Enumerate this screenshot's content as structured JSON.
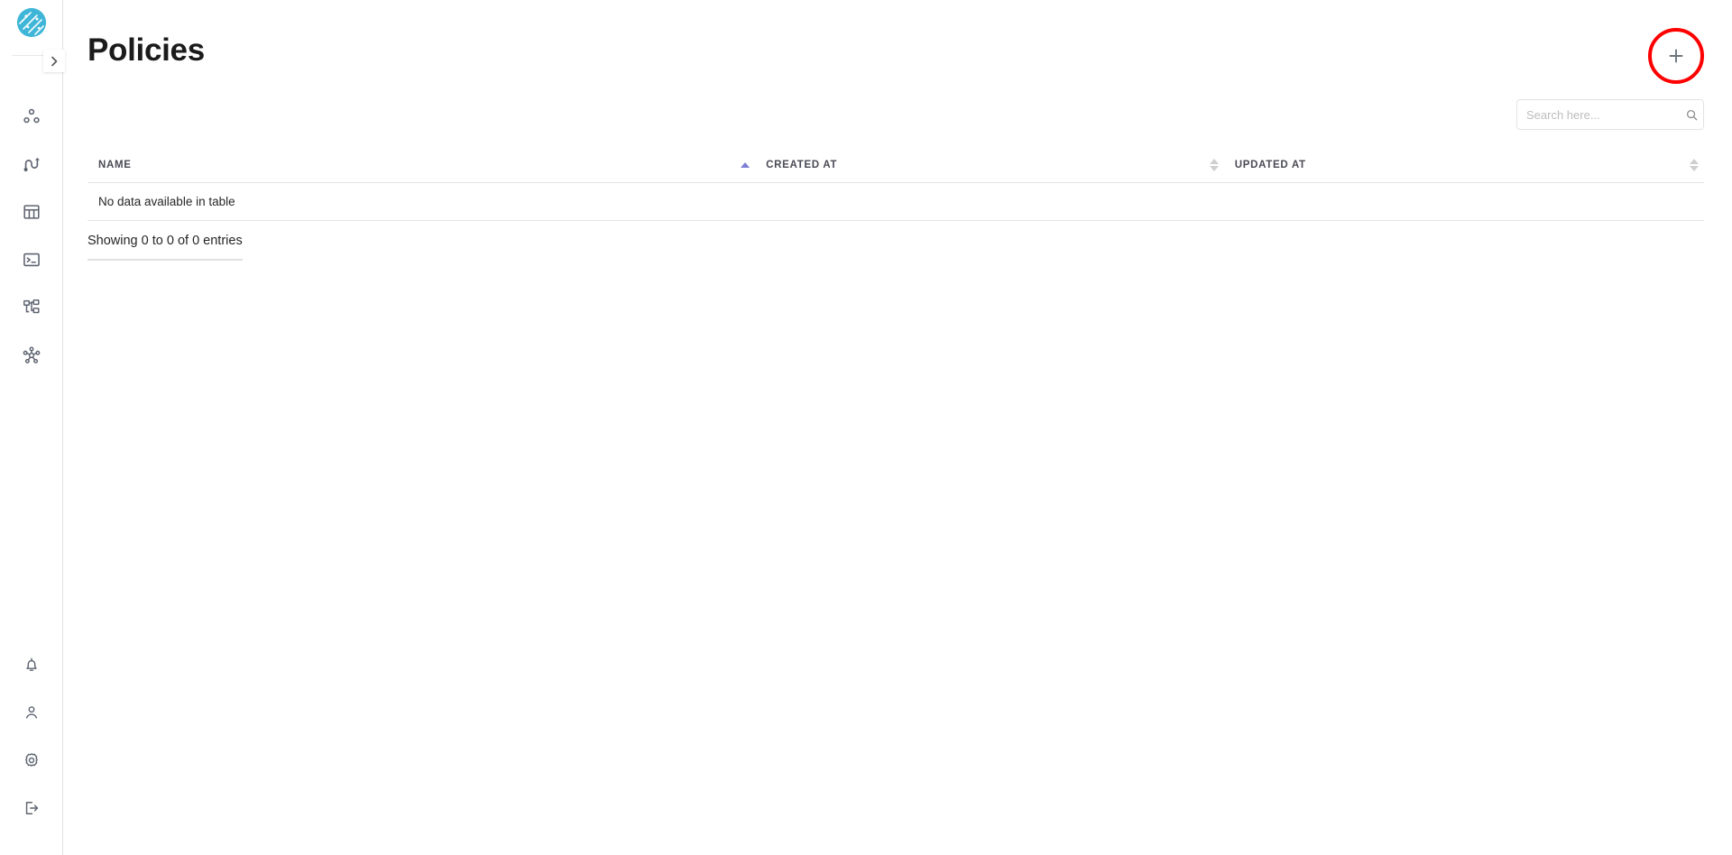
{
  "app": {
    "logo_name": "app-logo",
    "accent_color": "#3fb6d8",
    "annotation_color": "#fe0000",
    "sort_active_color": "#7b7fd4"
  },
  "sidebar": {
    "collapse_button": {
      "label": "›",
      "icon": "chevron-right-icon"
    },
    "top_items": [
      {
        "icon": "cluster-nodes-icon",
        "label": "Clusters"
      },
      {
        "icon": "pipeline-flow-icon",
        "label": "Pipelines"
      },
      {
        "icon": "table-grid-icon",
        "label": "Tables"
      },
      {
        "icon": "terminal-console-icon",
        "label": "Console"
      },
      {
        "icon": "sitemap-hierarchy-icon",
        "label": "Topology"
      },
      {
        "icon": "network-hub-icon",
        "label": "Network"
      }
    ],
    "bottom_items": [
      {
        "icon": "bell-notification-icon",
        "label": "Notifications"
      },
      {
        "icon": "user-profile-icon",
        "label": "Profile"
      },
      {
        "icon": "gear-settings-icon",
        "label": "Settings"
      },
      {
        "icon": "logout-icon",
        "label": "Log out"
      }
    ]
  },
  "header": {
    "title": "Policies",
    "add_button": {
      "label": "+",
      "icon": "plus-icon"
    }
  },
  "search": {
    "placeholder": "Search here...",
    "value": "",
    "icon": "search-icon"
  },
  "table": {
    "columns": [
      {
        "label": "NAME",
        "sort": "asc"
      },
      {
        "label": "CREATED AT",
        "sort": "none"
      },
      {
        "label": "UPDATED AT",
        "sort": "none"
      }
    ],
    "empty_message": "No data available in table",
    "rows": [],
    "footer_info": "Showing 0 to 0 of 0 entries"
  }
}
